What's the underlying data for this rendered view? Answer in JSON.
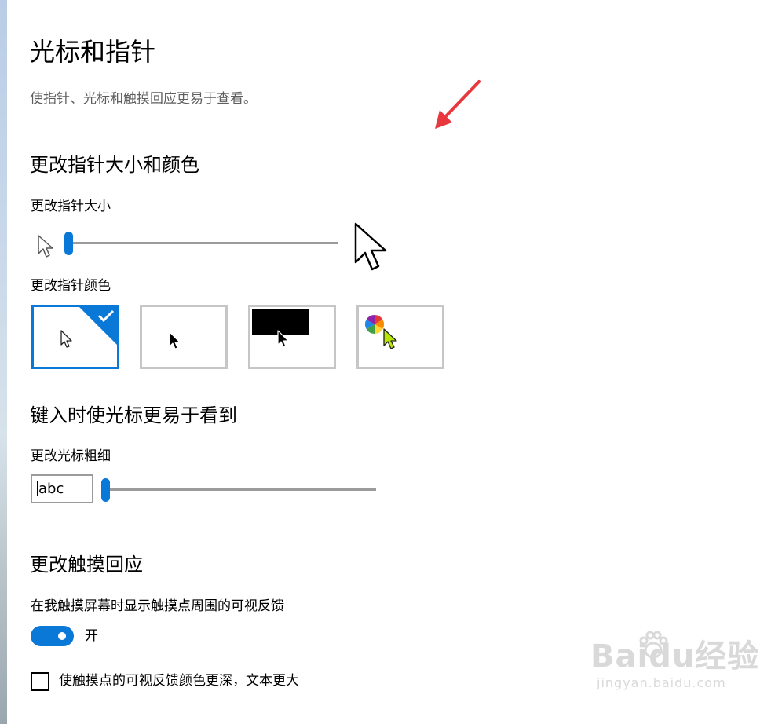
{
  "page": {
    "title": "光标和指针",
    "subtitle": "使指针、光标和触摸回应更易于查看。"
  },
  "pointer_section": {
    "title": "更改指针大小和颜色",
    "size_label": "更改指针大小",
    "size_value": 0.0,
    "color_label": "更改指针颜色",
    "color_options": [
      {
        "name": "white",
        "selected": true
      },
      {
        "name": "black",
        "selected": false
      },
      {
        "name": "inverted",
        "selected": false
      },
      {
        "name": "custom",
        "selected": false
      }
    ]
  },
  "cursor_section": {
    "title": "键入时使光标更易于看到",
    "thickness_label": "更改光标粗细",
    "preview_text": "abc",
    "thickness_value": 0.0
  },
  "touch_section": {
    "title": "更改触摸回应",
    "feedback_label": "在我触摸屏幕时显示触摸点周围的可视反馈",
    "toggle_state": "开",
    "toggle_on": true,
    "darker_label": "使触摸点的可视反馈颜色更深，文本更大",
    "darker_checked": false
  },
  "watermark": {
    "brand": "Baidu经验",
    "url": "jingyan.baidu.com"
  },
  "colors": {
    "accent": "#0a78d7",
    "arrow_annotation": "#e8383d",
    "custom_pointer": "#b8e600"
  }
}
